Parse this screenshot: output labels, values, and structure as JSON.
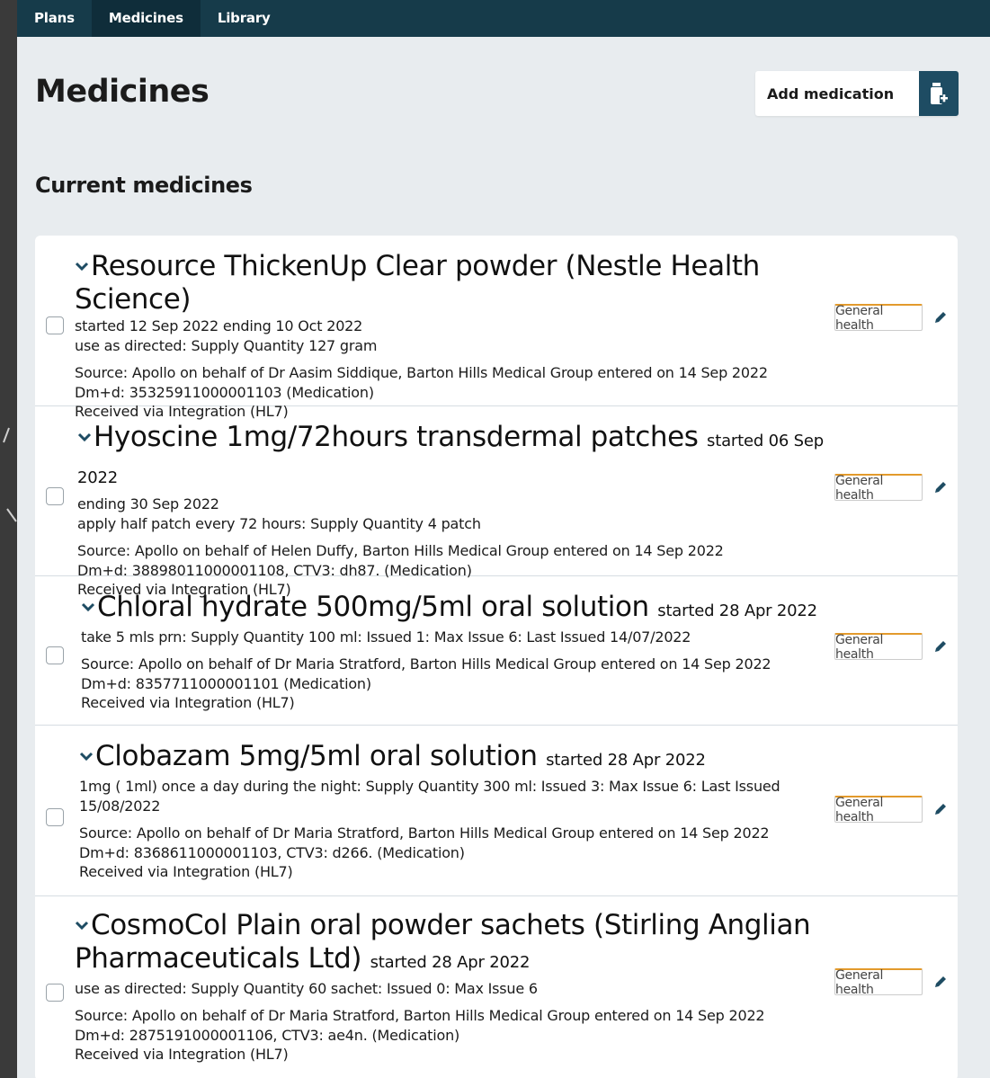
{
  "nav": {
    "items": [
      "Plans",
      "Medicines",
      "Library"
    ],
    "active": "Medicines"
  },
  "page": {
    "title": "Medicines",
    "add_button": "Add medication",
    "section_title": "Current medicines"
  },
  "medicines": [
    {
      "name": "Resource ThickenUp Clear powder (Nestle Health Science)",
      "started": "",
      "lines": [
        "started 12 Sep 2022 ending 10 Oct 2022",
        "use as directed: Supply Quantity 127 gram"
      ],
      "source": [
        "Source: Apollo on behalf of Dr Aasim Siddique, Barton Hills Medical Group entered on 14 Sep 2022",
        "Dm+d: 35325911000001103 (Medication)",
        "Received via Integration (HL7)"
      ],
      "tag": "General health"
    },
    {
      "name": "Hyoscine 1mg/72hours transdermal patches",
      "started": "started 06 Sep 2022",
      "lines": [
        "ending 30 Sep 2022",
        "apply half patch every 72 hours: Supply Quantity 4 patch"
      ],
      "source": [
        "Source: Apollo on behalf of Helen Duffy, Barton Hills Medical Group entered on 14 Sep 2022",
        "Dm+d: 38898011000001108, CTV3: dh87. (Medication)",
        "Received via Integration (HL7)"
      ],
      "tag": "General health"
    },
    {
      "name": "Chloral hydrate 500mg/5ml oral solution",
      "started": "started 28 Apr 2022",
      "lines": [
        "take 5 mls prn: Supply Quantity 100 ml: Issued 1: Max Issue 6: Last Issued 14/07/2022"
      ],
      "source": [
        "Source: Apollo on behalf of Dr Maria Stratford, Barton Hills Medical Group entered on 14 Sep 2022",
        "Dm+d: 8357711000001101 (Medication)",
        "Received via Integration (HL7)"
      ],
      "tag": "General health"
    },
    {
      "name": "Clobazam 5mg/5ml oral solution",
      "started": "started 28 Apr 2022",
      "lines": [
        "1mg ( 1ml) once a day during the night: Supply Quantity 300 ml: Issued 3: Max Issue 6: Last Issued",
        "15/08/2022"
      ],
      "source": [
        "Source: Apollo on behalf of Dr Maria Stratford, Barton Hills Medical Group entered on 14 Sep 2022",
        "Dm+d: 8368611000001103, CTV3: d266. (Medication)",
        "Received via Integration (HL7)"
      ],
      "tag": "General health"
    },
    {
      "name": "CosmoCol Plain oral powder sachets (Stirling Anglian Pharmaceuticals Ltd)",
      "started": "started 28 Apr 2022",
      "lines": [
        "use as directed: Supply Quantity 60 sachet: Issued 0: Max Issue 6"
      ],
      "source": [
        "Source: Apollo on behalf of Dr Maria Stratford, Barton Hills Medical Group entered on 14 Sep 2022",
        "Dm+d: 2875191000001106, CTV3: ae4n. (Medication)",
        "Received via Integration (HL7)"
      ],
      "tag": "General health"
    }
  ]
}
